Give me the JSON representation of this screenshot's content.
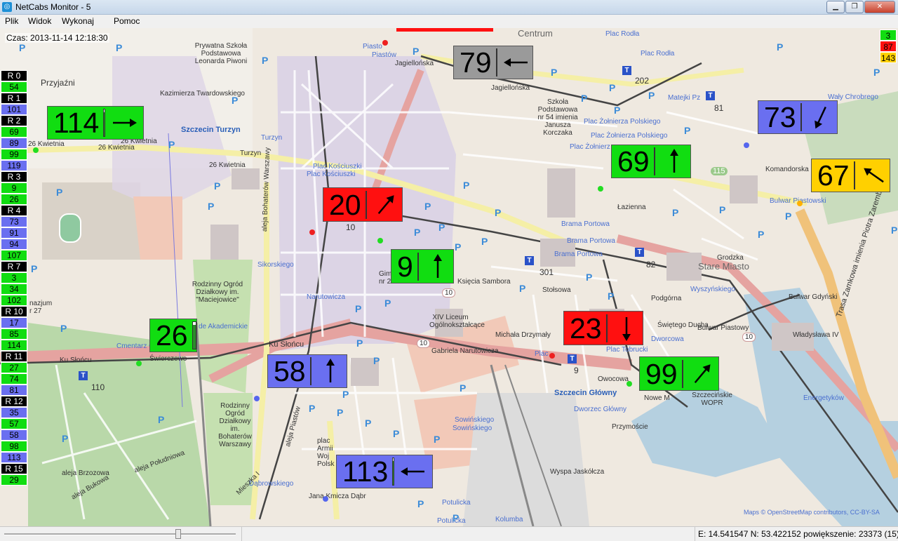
{
  "window": {
    "title": "NetCabs Monitor - 5",
    "icon": "app-icon"
  },
  "menu": {
    "items": [
      "Plik",
      "Widok",
      "Wykonaj",
      "Pomoc"
    ]
  },
  "time": {
    "label": "Czas:",
    "value": "2013-11-14 12:18:30"
  },
  "ranks": [
    {
      "label": "R 0",
      "type": "r"
    },
    {
      "label": "54",
      "type": "green"
    },
    {
      "label": "R 1",
      "type": "r"
    },
    {
      "label": "101",
      "type": "blue"
    },
    {
      "label": "R 2",
      "type": "r"
    },
    {
      "label": "69",
      "type": "green"
    },
    {
      "label": "89",
      "type": "blue"
    },
    {
      "label": "99",
      "type": "green"
    },
    {
      "label": "119",
      "type": "blue"
    },
    {
      "label": "R 3",
      "type": "r"
    },
    {
      "label": "9",
      "type": "green"
    },
    {
      "label": "26",
      "type": "green"
    },
    {
      "label": "R 4",
      "type": "r"
    },
    {
      "label": "73",
      "type": "blue"
    },
    {
      "label": "91",
      "type": "blue"
    },
    {
      "label": "94",
      "type": "blue"
    },
    {
      "label": "107",
      "type": "green"
    },
    {
      "label": "R 7",
      "type": "r"
    },
    {
      "label": "3",
      "type": "green"
    },
    {
      "label": "34",
      "type": "green"
    },
    {
      "label": "102",
      "type": "green"
    },
    {
      "label": "R 10",
      "type": "r"
    },
    {
      "label": "17",
      "type": "blue"
    },
    {
      "label": "85",
      "type": "green"
    },
    {
      "label": "114",
      "type": "green"
    },
    {
      "label": "R 11",
      "type": "r"
    },
    {
      "label": "27",
      "type": "green"
    },
    {
      "label": "74",
      "type": "green"
    },
    {
      "label": "81",
      "type": "blue"
    },
    {
      "label": "R 12",
      "type": "r"
    },
    {
      "label": "35",
      "type": "blue"
    },
    {
      "label": "57",
      "type": "green"
    },
    {
      "label": "58",
      "type": "blue"
    },
    {
      "label": "98",
      "type": "green"
    },
    {
      "label": "113",
      "type": "blue"
    },
    {
      "label": "R 15",
      "type": "r"
    },
    {
      "label": "29",
      "type": "green"
    }
  ],
  "counters": [
    {
      "label": "3",
      "color": "#11dd11"
    },
    {
      "label": "87",
      "color": "#ff1010"
    },
    {
      "label": "143",
      "color": "#ffd000"
    }
  ],
  "cabs": [
    {
      "number": "114",
      "color": "green",
      "fill": 0.9,
      "direction": "east"
    },
    {
      "number": "79",
      "color": "gray",
      "fill": 0.3,
      "direction": "west"
    },
    {
      "number": "73",
      "color": "blue",
      "fill": 0.9,
      "direction": "south-west"
    },
    {
      "number": "69",
      "color": "green",
      "fill": 0.9,
      "direction": "north"
    },
    {
      "number": "67",
      "color": "yellow",
      "fill": 0.9,
      "direction": "north-west"
    },
    {
      "number": "20",
      "color": "red",
      "fill": 0.9,
      "direction": "north-east"
    },
    {
      "number": "9",
      "color": "green",
      "fill": 0.9,
      "direction": "north"
    },
    {
      "number": "26",
      "color": "green",
      "fill": 0.9,
      "direction": "none"
    },
    {
      "number": "23",
      "color": "red",
      "fill": 0.9,
      "direction": "south"
    },
    {
      "number": "58",
      "color": "blue",
      "fill": 0.9,
      "direction": "north"
    },
    {
      "number": "99",
      "color": "green",
      "fill": 0.9,
      "direction": "north-east"
    },
    {
      "number": "113",
      "color": "blue",
      "fill": 0.9,
      "direction": "west"
    }
  ],
  "map_labels": {
    "centrum": "Centrum",
    "plac_rodla": "Plac Rodła",
    "plac_rodla2": "Plac Rodła",
    "przyjazni": "Przyjaźni",
    "szczecin_turzyn": "Szczecin Turzyn",
    "turzyn": "Turzyn",
    "turzyn2": "Turzyn",
    "plac_kosciuszki": "Plac Kościuszki",
    "plac_kosciuszki2": "Plac Kościuszki",
    "piastow": "Piastów",
    "piasto": "Piasto",
    "jagiellonska": "Jagiellońska",
    "jagiellonska2": "Jagiellońska",
    "szkola": "Prywatna Szkoła Podstawowa Leonarda Piwoni",
    "szkola54": "Szkoła Podstawowa nr 54 imienia Janusza Korczaka",
    "kazimierza": "Kazimierza Twardowskiego",
    "plac_zolnierza": "Plac Żołnierza Polskiego",
    "plac_zolnierza2": "Plac Żołnierza Polskiego",
    "plac_zolnierza3": "Plac Żołnierz",
    "matejki": "Matejki Pz",
    "waly": "Wały Chrobrego",
    "brama_portowa": "Brama Portowa",
    "brama_portowa2": "Brama Portowa",
    "brama_portowa3": "Brama Portowa",
    "stare_miasto": "Stare Miasto",
    "bulwar": "Bulwar Piastowski",
    "sikorskiego": "Sikorskiego",
    "narutowicza": "Narutowicza",
    "rodzinny": "Rodzinny Ogród Działkowy im. \"Maciejowice\"",
    "akademickie": "de Akademickie",
    "ku_sloncu": "Ku Słońcu",
    "ku_sloncu2": "Ku Słońcu",
    "swierczewo": "Świerczewo",
    "cmentarz": "Cmentarz C",
    "gabriela": "Gabriela Narutowicza",
    "xiv": "XIV Liceum Ogólnokształcące",
    "ksiecia_sambora": "Księcia Sambora",
    "szczecin_glowny": "Szczecin Główny",
    "dworzec_glowny": "Dworzec Główny",
    "dworcowa": "Dworcowa",
    "plac_tobrucki": "Plac Tobrucki",
    "wyszynskiego": "Wyszyńskiego",
    "sowinskiego": "Sowińskiego",
    "sowinskiego2": "Sowińskiego",
    "rodzinny2": "Rodzinny Ogród Działkowy im. Bohaterów Warszawy",
    "plac_armii": "plac Armii Woj Polsk",
    "dabrowskiego": "Dąbrowskiego",
    "potulicka": "Potulicka",
    "potulicka2": "Potulicka",
    "kolumba": "Kolumba",
    "wyspa": "Wyspa Jaskółcza",
    "przymoscie": "Przymoście",
    "energetykow": "Energetyków",
    "trasa": "Trasa Zamkowa imienia Piotra Zaremby",
    "wopr": "Szczecińskie WOPR",
    "mieszka": "Mieszka I",
    "janakmicza": "Jana Kmicza Dąbr",
    "aleja_brzozowa": "aleja Brzozowa",
    "aleja_bukowa": "aleja Bukowa",
    "aleja_poludniowa": "aleja Południowa",
    "aleja_piastow": "aleja Piastów",
    "aleja_bohaterow": "aleja Bohaterów Warszawy",
    "gimnazjum": "Gimnaz nr 2",
    "gimnazjum27": "nazjum r 27",
    "kwietnia1": "26 Kwietnia",
    "kwietnia2": "26 Kwietnia",
    "kwietnia3": "26 Kwietnia",
    "kwietnia4": "26 Kwietnia",
    "pl": "Plac",
    "michala": "Michała Drzymały",
    "stoisowa": "Stołsowa",
    "owocowa": "Owocowa",
    "nowe": "Nowe M",
    "grodzka": "Grodzka",
    "podgorna": "Podgórna",
    "lazienna": "Łazienna",
    "bulwar_gdynski": "Bulwar Gdyński",
    "wladyslawa": "Władysława IV",
    "sw_ducha": "Świętego Ducha",
    "bulwar_przestrzenny": "Bulwar Piastowy",
    "komandorska": "Komandorska",
    "stop_202": "202",
    "stop_81": "81",
    "stop_82": "82",
    "stop_301": "301",
    "stop_9": "9",
    "stop_110": "110",
    "stop_10": "10",
    "route_115": "115",
    "route_10a": "10",
    "route_10b": "10",
    "route_10c": "10",
    "attribution": "Maps © OpenStreetMap contributors, CC-BY-SA"
  },
  "statusbar": {
    "coords": "E: 14.541547  N: 53.422152  powiększenie: 23373 (15)"
  }
}
